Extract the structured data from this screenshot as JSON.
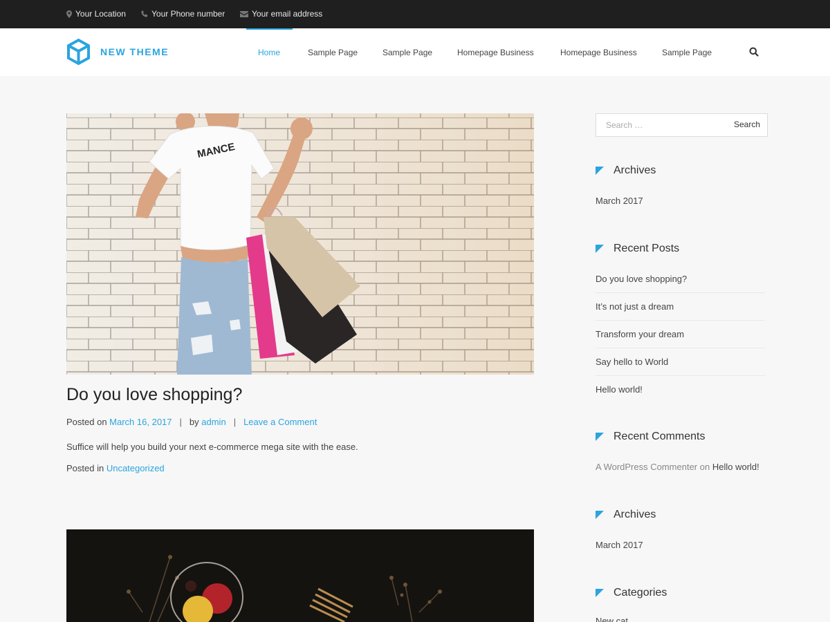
{
  "topbar": {
    "location": "Your Location",
    "phone": "Your Phone number",
    "email": "Your email address"
  },
  "header": {
    "logo_text": "NEW THEME",
    "nav": [
      {
        "label": "Home",
        "active": true
      },
      {
        "label": "Sample Page",
        "active": false
      },
      {
        "label": "Sample Page",
        "active": false
      },
      {
        "label": "Homepage Business",
        "active": false
      },
      {
        "label": "Homepage Business",
        "active": false
      },
      {
        "label": "Sample Page",
        "active": false
      }
    ]
  },
  "post": {
    "title": "Do you love shopping?",
    "posted_on_label": "Posted on",
    "date": "March 16, 2017",
    "by_label": "by",
    "author": "admin",
    "comment_link": "Leave a Comment",
    "excerpt": "Suffice will help you build your next e-commerce mega site with the ease.",
    "posted_in_label": "Posted in",
    "category": "Uncategorized"
  },
  "sidebar": {
    "search": {
      "placeholder": "Search …",
      "button": "Search"
    },
    "archives_title": "Archives",
    "archives": [
      "March 2017"
    ],
    "recent_posts_title": "Recent Posts",
    "recent_posts": [
      "Do you love shopping?",
      "It’s not just a dream",
      "Transform your dream",
      "Say hello to World",
      "Hello world!"
    ],
    "recent_comments_title": "Recent Comments",
    "recent_comment": {
      "author": "A WordPress Commenter",
      "on_label": "on",
      "post": "Hello world!"
    },
    "archives2_title": "Archives",
    "archives2": [
      "March 2017"
    ],
    "categories_title": "Categories",
    "categories": [
      "New cat"
    ]
  },
  "colors": {
    "accent": "#2aa5de",
    "topbar_bg": "#1f1f1f",
    "page_bg": "#f7f7f7"
  }
}
